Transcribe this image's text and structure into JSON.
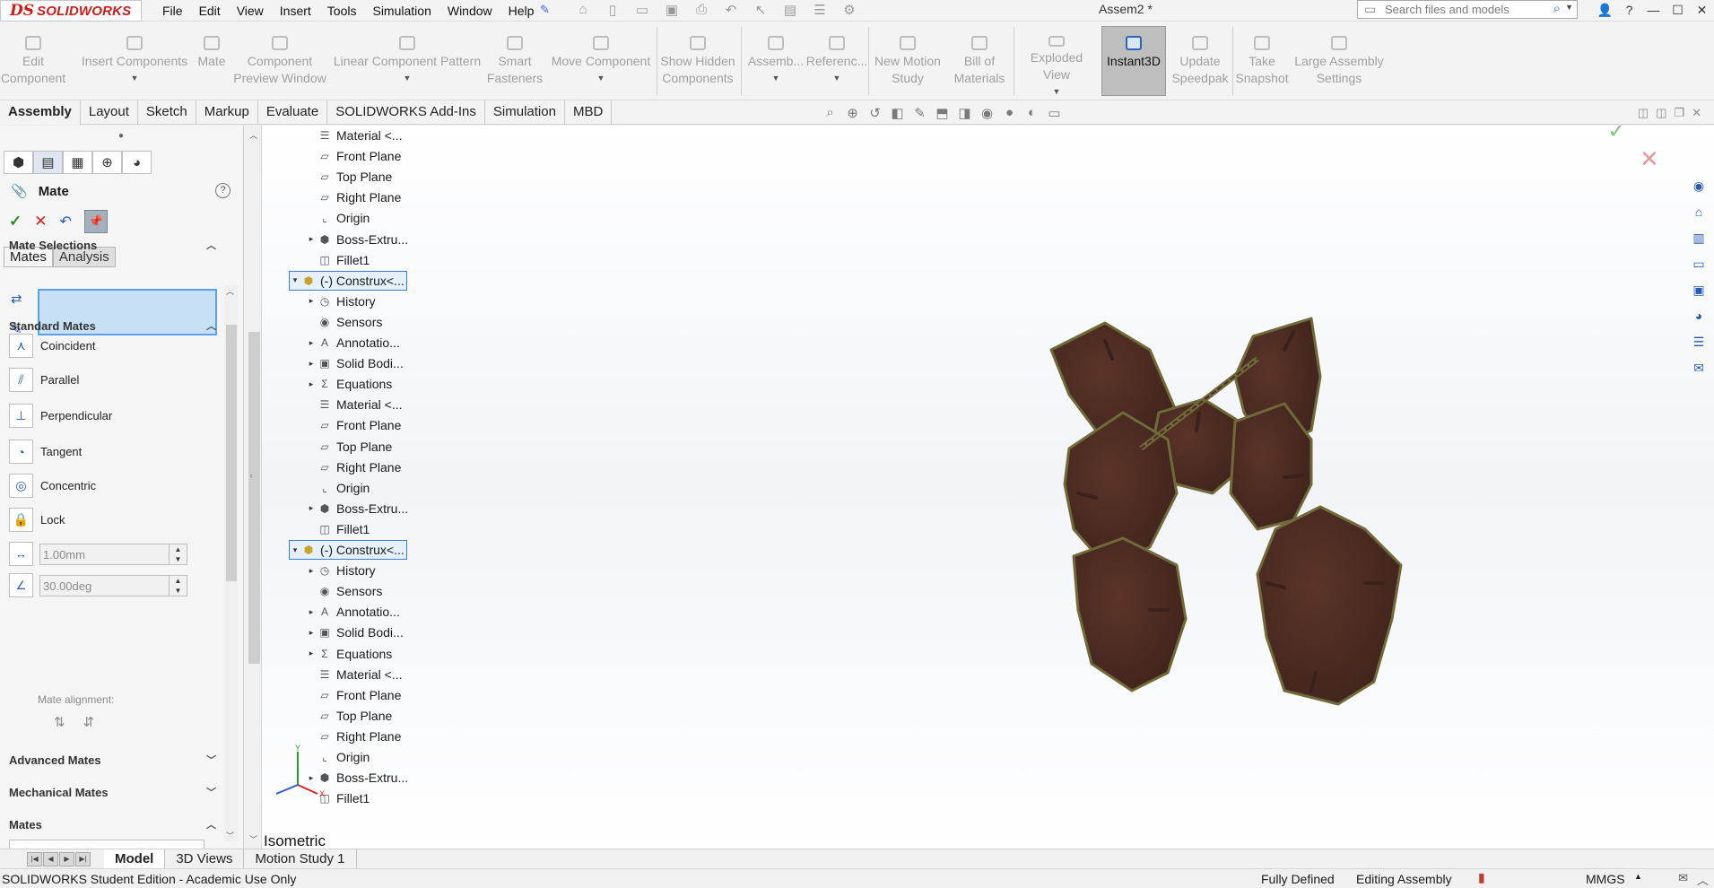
{
  "app": {
    "brand_mark": "DS",
    "brand_name": "SOLIDWORKS",
    "doc_title": "Assem2 *"
  },
  "menu": [
    "File",
    "Edit",
    "View",
    "Insert",
    "Tools",
    "Simulation",
    "Window",
    "Help"
  ],
  "search": {
    "placeholder": "Search files and models"
  },
  "command_manager": {
    "edit_component": "Edit Component",
    "insert_components": "Insert Components",
    "mate": "Mate",
    "component_preview": "Component Preview Window",
    "linear_pattern": "Linear Component Pattern",
    "smart_fasteners": "Smart Fasteners",
    "move_component": "Move Component",
    "show_hidden": "Show Hidden Components",
    "assembly": "Assemb...",
    "reference": "Referenc...",
    "new_motion": "New Motion Study",
    "bom": "Bill of Materials",
    "exploded": "Exploded View",
    "instant3d": "Instant3D",
    "speedpak": "Update Speedpak",
    "snapshot": "Take Snapshot",
    "large_assembly": "Large Assembly Settings"
  },
  "tabs": [
    "Assembly",
    "Layout",
    "Sketch",
    "Markup",
    "Evaluate",
    "SOLIDWORKS Add-Ins",
    "Simulation",
    "MBD"
  ],
  "property_manager": {
    "title": "Mate",
    "subtabs": [
      "Mates",
      "Analysis"
    ],
    "groups": {
      "mate_selections": "Mate Selections",
      "standard_mates": "Standard Mates",
      "advanced_mates": "Advanced Mates",
      "mechanical_mates": "Mechanical Mates",
      "mates": "Mates"
    },
    "standard_mates": [
      "Coincident",
      "Parallel",
      "Perpendicular",
      "Tangent",
      "Concentric",
      "Lock"
    ],
    "distance_value": "1.00mm",
    "angle_value": "30.00deg",
    "mate_alignment": "Mate alignment:"
  },
  "tree": [
    {
      "label": "Material <...",
      "icon": "material",
      "exp": ""
    },
    {
      "label": "Front Plane",
      "icon": "plane",
      "exp": ""
    },
    {
      "label": "Top Plane",
      "icon": "plane",
      "exp": ""
    },
    {
      "label": "Right Plane",
      "icon": "plane",
      "exp": ""
    },
    {
      "label": "Origin",
      "icon": "origin",
      "exp": ""
    },
    {
      "label": "Boss-Extru...",
      "icon": "extrude",
      "exp": "▸"
    },
    {
      "label": "Fillet1",
      "icon": "fillet",
      "exp": ""
    },
    {
      "label": "(-) Construx<...",
      "icon": "part",
      "exp": "▾",
      "level": 0
    },
    {
      "label": "History",
      "icon": "history",
      "exp": "▸"
    },
    {
      "label": "Sensors",
      "icon": "sensor",
      "exp": ""
    },
    {
      "label": "Annotatio...",
      "icon": "annotation",
      "exp": "▸"
    },
    {
      "label": "Solid Bodi...",
      "icon": "solid",
      "exp": "▸"
    },
    {
      "label": "Equations",
      "icon": "equation",
      "exp": "▸"
    },
    {
      "label": "Material <...",
      "icon": "material",
      "exp": ""
    },
    {
      "label": "Front Plane",
      "icon": "plane",
      "exp": ""
    },
    {
      "label": "Top Plane",
      "icon": "plane",
      "exp": ""
    },
    {
      "label": "Right Plane",
      "icon": "plane",
      "exp": ""
    },
    {
      "label": "Origin",
      "icon": "origin",
      "exp": ""
    },
    {
      "label": "Boss-Extru...",
      "icon": "extrude",
      "exp": "▸"
    },
    {
      "label": "Fillet1",
      "icon": "fillet",
      "exp": ""
    },
    {
      "label": "(-) Construx<...",
      "icon": "part",
      "exp": "▾",
      "level": 0
    },
    {
      "label": "History",
      "icon": "history",
      "exp": "▸"
    },
    {
      "label": "Sensors",
      "icon": "sensor",
      "exp": ""
    },
    {
      "label": "Annotatio...",
      "icon": "annotation",
      "exp": "▸"
    },
    {
      "label": "Solid Bodi...",
      "icon": "solid",
      "exp": "▸"
    },
    {
      "label": "Equations",
      "icon": "equation",
      "exp": "▸"
    },
    {
      "label": "Material <...",
      "icon": "material",
      "exp": ""
    },
    {
      "label": "Front Plane",
      "icon": "plane",
      "exp": ""
    },
    {
      "label": "Top Plane",
      "icon": "plane",
      "exp": ""
    },
    {
      "label": "Right Plane",
      "icon": "plane",
      "exp": ""
    },
    {
      "label": "Origin",
      "icon": "origin",
      "exp": ""
    },
    {
      "label": "Boss-Extru...",
      "icon": "extrude",
      "exp": "▸"
    },
    {
      "label": "Fillet1",
      "icon": "fillet",
      "exp": ""
    }
  ],
  "view": {
    "orientation": "Isometric"
  },
  "bottom_tabs": [
    "Model",
    "3D Views",
    "Motion Study 1"
  ],
  "status": {
    "left": "SOLIDWORKS Student Edition - Academic Use Only",
    "definition": "Fully Defined",
    "mode": "Editing Assembly",
    "units": "MMGS"
  },
  "colors": {
    "accent": "#3a6dd8",
    "brand": "#d01a1a",
    "part_face": "#4a2a22",
    "part_edge": "#6f6a3a",
    "selection_box": "#c7e0f6"
  }
}
